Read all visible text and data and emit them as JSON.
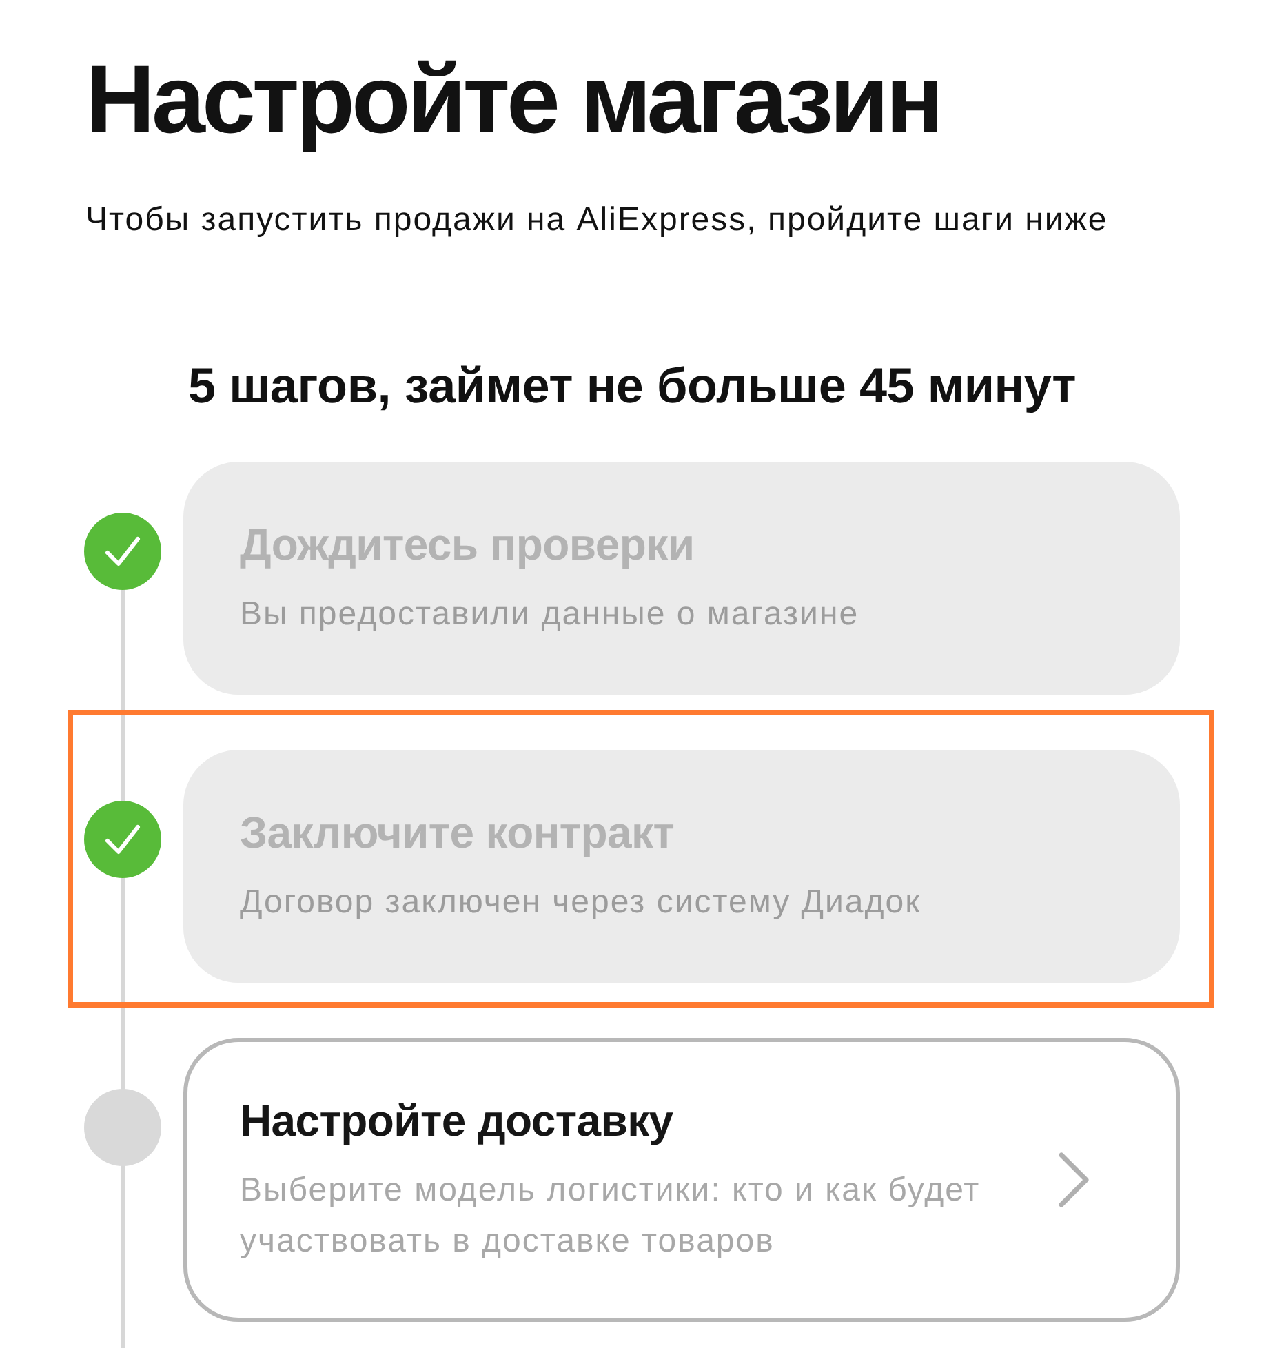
{
  "page": {
    "title": "Настройте магазин",
    "subtitle": "Чтобы запустить продажи на AliExpress, пройдите шаги ниже"
  },
  "steps_summary": "5 шагов, займет не больше 45 минут",
  "steps": [
    {
      "title": "Дождитесь проверки",
      "description": "Вы предоставили данные о магазине",
      "completed": true,
      "highlighted": false
    },
    {
      "title": "Заключите контракт",
      "description": "Договор заключен через систему Диадок",
      "completed": true,
      "highlighted": true
    },
    {
      "title": "Настройте доставку",
      "description": "Выберите модель логистики: кто и как будет участвовать в доставке товаров",
      "completed": false,
      "highlighted": false
    }
  ]
}
